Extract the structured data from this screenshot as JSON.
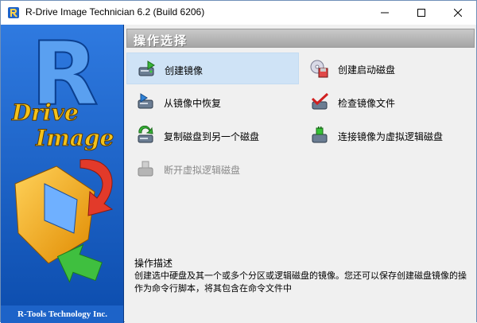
{
  "window": {
    "title": "R-Drive Image Technician 6.2 (Build 6206)"
  },
  "brand": {
    "logo_text_line1": "Drive",
    "logo_text_line2": "Image",
    "logo_letter": "R",
    "footer": "R-Tools Technology Inc."
  },
  "operations": {
    "header": "操作选择",
    "items": [
      {
        "label": "创建镜像",
        "icon": "create-image-icon",
        "state": "selected"
      },
      {
        "label": "创建启动磁盘",
        "icon": "boot-disk-icon",
        "state": "normal"
      },
      {
        "label": "从镜像中恢复",
        "icon": "restore-icon",
        "state": "normal"
      },
      {
        "label": "检查镜像文件",
        "icon": "check-image-icon",
        "state": "normal"
      },
      {
        "label": "复制磁盘到另一个磁盘",
        "icon": "copy-disk-icon",
        "state": "normal"
      },
      {
        "label": "连接镜像为虚拟逻辑磁盘",
        "icon": "connect-virtual-disk-icon",
        "state": "normal"
      },
      {
        "label": "断开虚拟逻辑磁盘",
        "icon": "disconnect-virtual-disk-icon",
        "state": "disabled"
      }
    ]
  },
  "description": {
    "title": "操作描述",
    "text": "创建选中硬盘及其一个或多个分区或逻辑磁盘的镜像。您还可以保存创建磁盘镜像的操作为命令行脚本，将其包含在命令文件中"
  },
  "colors": {
    "left_panel": "#1d63c8",
    "header_bg": "#b5b5b5",
    "selected_bg": "#cfe3f6",
    "disabled_text": "#8a8a8a"
  }
}
